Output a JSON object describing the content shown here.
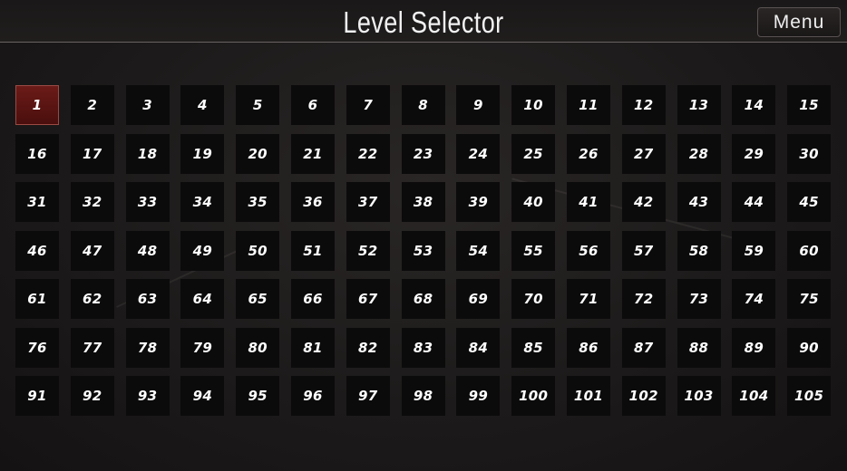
{
  "header": {
    "title": "Level Selector",
    "menu_label": "Menu"
  },
  "levels": {
    "selected": 1,
    "items": [
      "1",
      "2",
      "3",
      "4",
      "5",
      "6",
      "7",
      "8",
      "9",
      "10",
      "11",
      "12",
      "13",
      "14",
      "15",
      "16",
      "17",
      "18",
      "19",
      "20",
      "21",
      "22",
      "23",
      "24",
      "25",
      "26",
      "27",
      "28",
      "29",
      "30",
      "31",
      "32",
      "33",
      "34",
      "35",
      "36",
      "37",
      "38",
      "39",
      "40",
      "41",
      "42",
      "43",
      "44",
      "45",
      "46",
      "47",
      "48",
      "49",
      "50",
      "51",
      "52",
      "53",
      "54",
      "55",
      "56",
      "57",
      "58",
      "59",
      "60",
      "61",
      "62",
      "63",
      "64",
      "65",
      "66",
      "67",
      "68",
      "69",
      "70",
      "71",
      "72",
      "73",
      "74",
      "75",
      "76",
      "77",
      "78",
      "79",
      "80",
      "81",
      "82",
      "83",
      "84",
      "85",
      "86",
      "87",
      "88",
      "89",
      "90",
      "91",
      "92",
      "93",
      "94",
      "95",
      "96",
      "97",
      "98",
      "99",
      "100",
      "101",
      "102",
      "103",
      "104",
      "105"
    ]
  },
  "colors": {
    "selected_tile": "#6b1b18",
    "tile": "#0c0b0b",
    "text": "#ffffff"
  }
}
